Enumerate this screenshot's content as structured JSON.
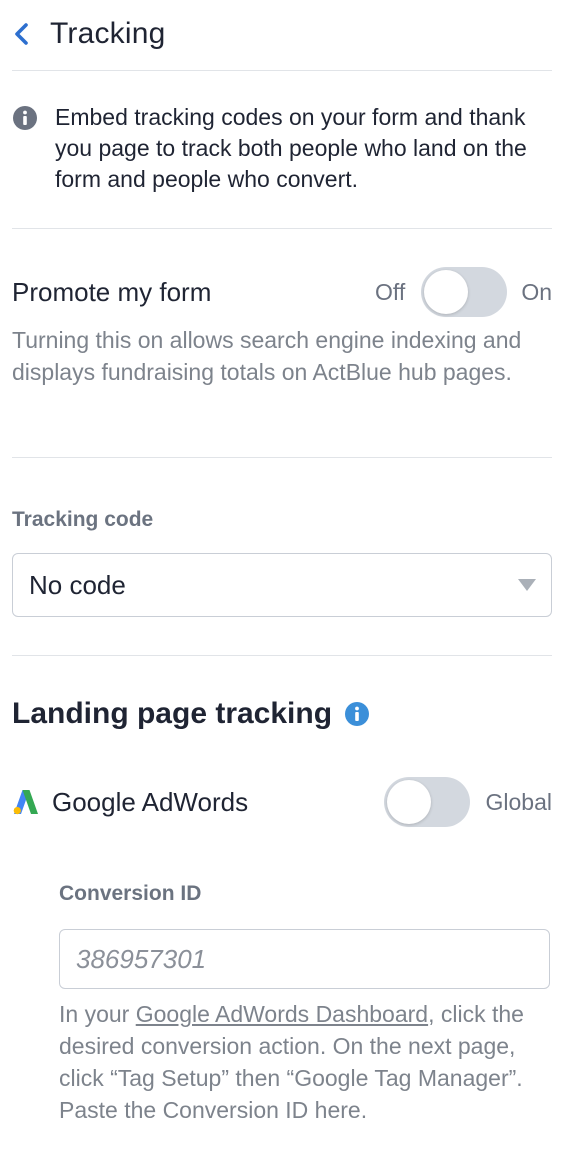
{
  "header": {
    "title": "Tracking",
    "back_icon": "chevron-left-icon"
  },
  "info": {
    "icon": "info-icon",
    "text": "Embed tracking codes on your form and thank you page to track both people who land on the form and people who convert."
  },
  "promote": {
    "label": "Promote my form",
    "off_label": "Off",
    "on_label": "On",
    "enabled": false,
    "description": "Turning this on allows search engine indexing and displays fundraising totals on ActBlue hub pages."
  },
  "tracking_code": {
    "label": "Tracking code",
    "selected": "No code"
  },
  "landing": {
    "title": "Landing page tracking",
    "info_icon": "info-icon"
  },
  "adwords": {
    "logo": "google-adwords-logo",
    "label": "Google AdWords",
    "toggle_label": "Global",
    "enabled": false,
    "conversion_label": "Conversion ID",
    "conversion_placeholder": "386957301",
    "help_prefix": "In your ",
    "help_link": "Google AdWords Dashboard",
    "help_suffix": ", click the desired conversion action. On the next page, click “Tag Setup” then “Google Tag Manager”. Paste the Conversion ID here."
  },
  "colors": {
    "accent": "#2d6fcf",
    "info_icon_gray": "#6b7280",
    "info_icon_blue": "#3b8fd9",
    "toggle_off": "#d3d8df",
    "adwords_blue": "#4285f4",
    "adwords_green": "#34a853",
    "adwords_yellow": "#fbbc04"
  }
}
